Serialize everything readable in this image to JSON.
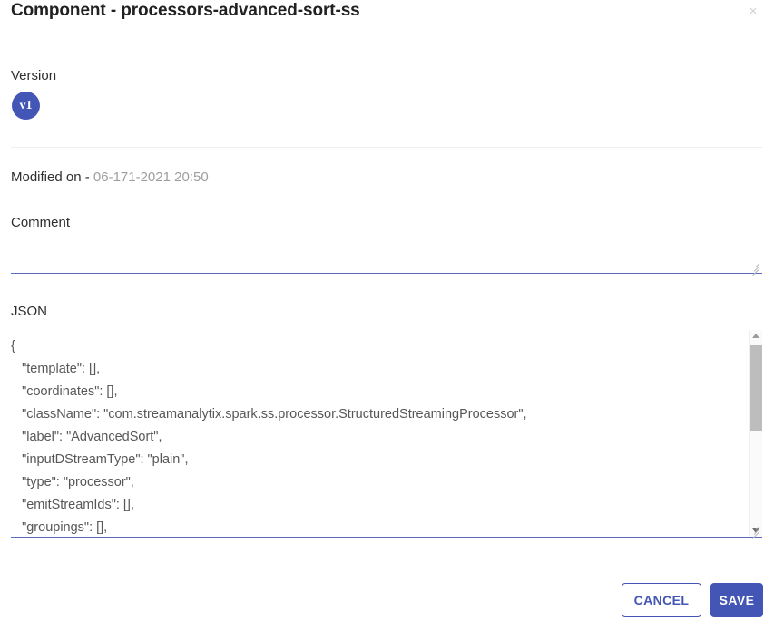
{
  "dialog": {
    "title": "Component - processors-advanced-sort-ss",
    "close_icon": "close-icon",
    "close_glyph": "×"
  },
  "version": {
    "label": "Version",
    "badge": "v1",
    "badge_color": "#4355b5"
  },
  "modified": {
    "label": "Modified on - ",
    "value": "06-171-2021 20:50"
  },
  "comment": {
    "label": "Comment",
    "value": "",
    "placeholder": ""
  },
  "json_section": {
    "label": "JSON",
    "value": "{\n   \"template\": [],\n   \"coordinates\": [],\n   \"className\": \"com.streamanalytix.spark.ss.processor.StructuredStreamingProcessor\",\n   \"label\": \"AdvancedSort\",\n   \"inputDStreamType\": \"plain\",\n   \"type\": \"processor\",\n   \"emitStreamIds\": [],\n   \"groupings\": [],"
  },
  "footer": {
    "cancel_label": "CANCEL",
    "save_label": "SAVE"
  }
}
